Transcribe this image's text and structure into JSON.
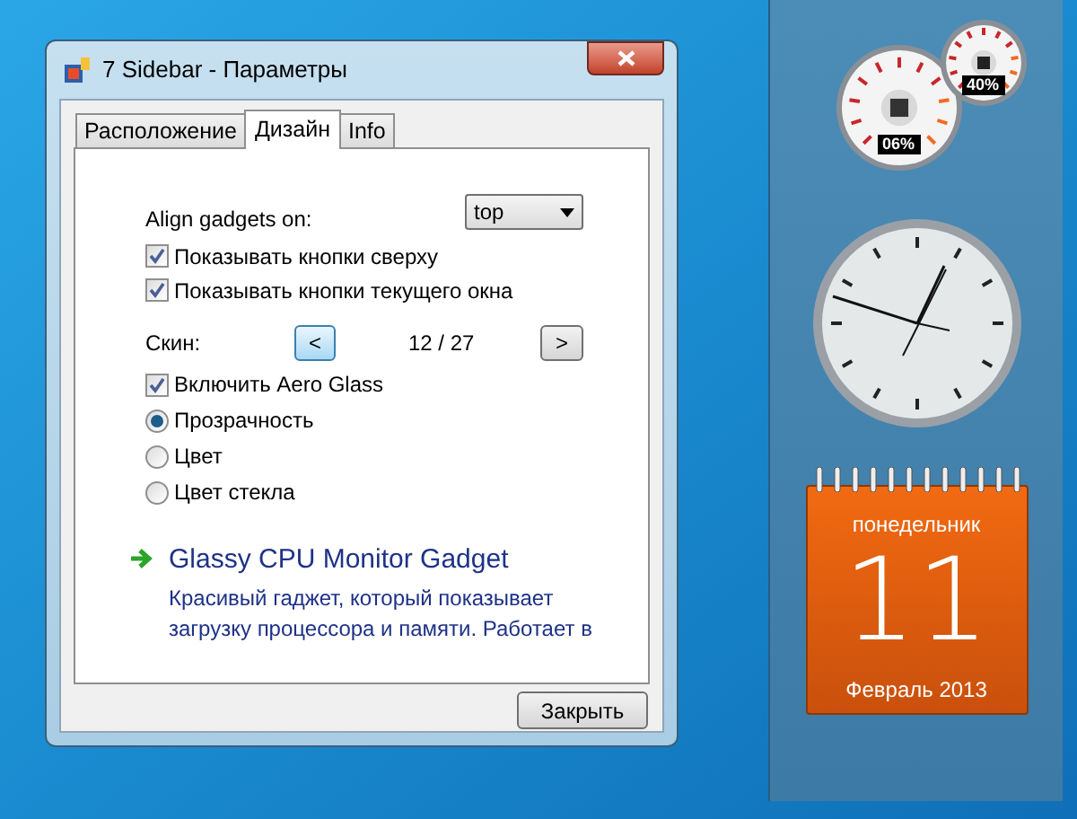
{
  "window": {
    "title": "7 Sidebar - Параметры"
  },
  "tabs": [
    {
      "label": "Расположение",
      "selected": false
    },
    {
      "label": "Дизайн",
      "selected": true
    },
    {
      "label": "Info",
      "selected": false
    }
  ],
  "align": {
    "label": "Align gadgets on:",
    "value": "top"
  },
  "top_checkboxes": [
    {
      "label": "Показывать кнопки сверху",
      "checked": true
    },
    {
      "label": "Показывать кнопки текущего окна",
      "checked": true
    }
  ],
  "skin": {
    "label": "Скин:",
    "prev": "<",
    "counter": "12 / 27",
    "next": ">"
  },
  "aero_checkbox": {
    "label": "Включить Aero Glass",
    "checked": true
  },
  "radios": [
    {
      "label": "Прозрачность",
      "selected": true
    },
    {
      "label": "Цвет",
      "selected": false
    },
    {
      "label": "Цвет стекла",
      "selected": false
    }
  ],
  "gadget": {
    "title": "Glassy CPU Monitor Gadget",
    "description": "Красивый гаджет, который показывает загрузку процессора и памяти. Работает в"
  },
  "close_button": "Закрыть",
  "sidebar": {
    "cpu_gauge": {
      "reading": "06%"
    },
    "memory_gauge": {
      "reading": "40%"
    },
    "calendar": {
      "weekday": "понедельник",
      "day": "11",
      "month_year": "Февраль 2013"
    }
  }
}
